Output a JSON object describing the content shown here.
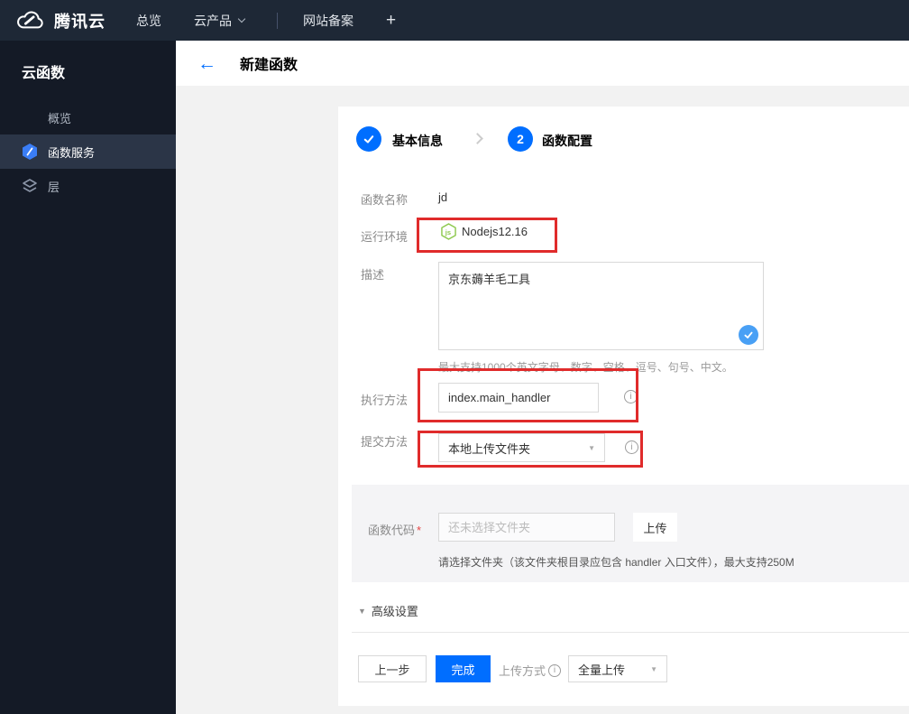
{
  "colors": {
    "accent_blue": "#006eff",
    "annotation_red": "#e02b2b",
    "node_green": "#8cc84b",
    "check_badge_blue": "#49a0f5",
    "topbar_bg": "#1e2836",
    "sidebar_bg": "#141a26"
  },
  "icons": {
    "caret_down": "▼",
    "info_letter": "i"
  },
  "topbar": {
    "brand": "腾讯云",
    "nav": [
      {
        "label": "总览"
      },
      {
        "label": "云产品"
      },
      {
        "label": "网站备案"
      }
    ],
    "plus": "+"
  },
  "sidebar": {
    "title": "云函数",
    "items": [
      {
        "label": "概览",
        "icon": "grid-icon",
        "active": false
      },
      {
        "label": "函数服务",
        "icon": "scf-hexagon-icon",
        "active": true
      },
      {
        "label": "层",
        "icon": "layers-icon",
        "active": false
      }
    ]
  },
  "header": {
    "back_arrow": "←",
    "title": "新建函数"
  },
  "steps": [
    {
      "indicator": "✓",
      "label": "基本信息",
      "state": "done"
    },
    {
      "indicator": "2",
      "label": "函数配置",
      "state": "current"
    }
  ],
  "form": {
    "name": {
      "label": "函数名称",
      "value": "jd"
    },
    "runtime": {
      "label": "运行环境",
      "value": "Nodejs12.16",
      "icon": "nodejs-icon",
      "icon_text": "js"
    },
    "description": {
      "label": "描述",
      "value": "京东薅羊毛工具",
      "hint": "最大支持1000个英文字母、数字、空格、逗号、句号、中文。"
    },
    "handler": {
      "label": "执行方法",
      "value": "index.main_handler"
    },
    "submit_method": {
      "label": "提交方法",
      "value": "本地上传文件夹"
    },
    "code": {
      "label": "函数代码",
      "required_mark": "*",
      "placeholder": "还未选择文件夹",
      "upload_button": "上传",
      "hint": "请选择文件夹（该文件夹根目录应包含 handler 入口文件），最大支持250M"
    },
    "advanced_label": "高级设置"
  },
  "footer": {
    "prev_button": "上一步",
    "finish_button": "完成",
    "upload_mode_label": "上传方式",
    "upload_mode_value": "全量上传"
  }
}
